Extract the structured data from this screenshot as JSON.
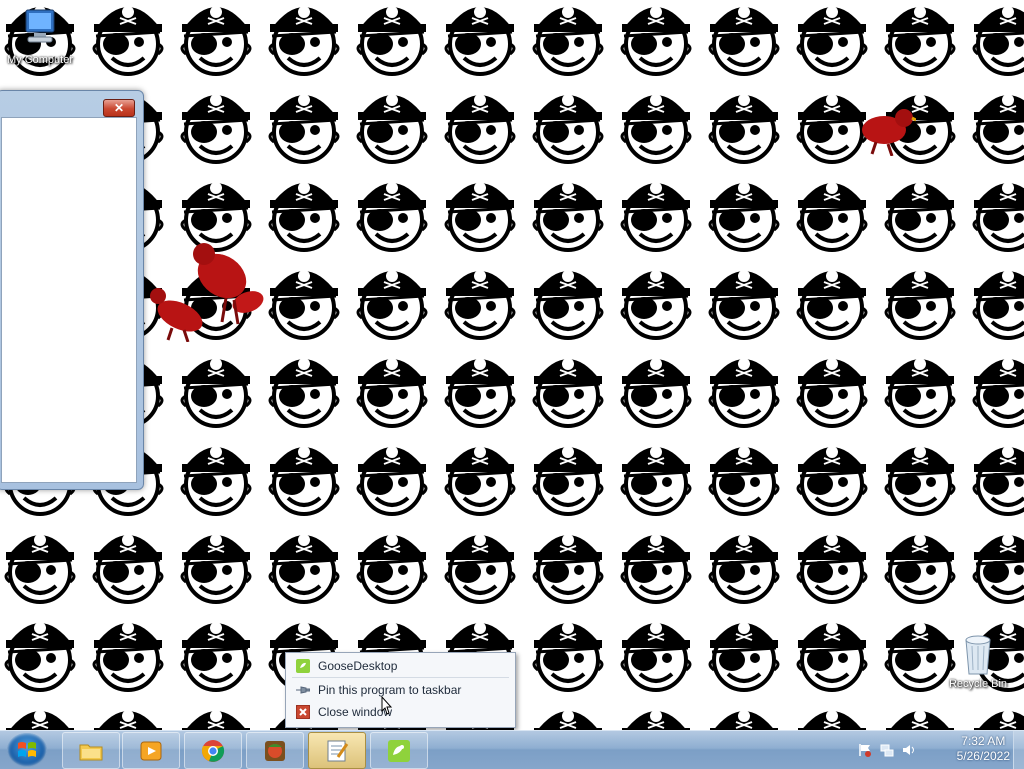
{
  "desktop": {
    "icons": [
      {
        "label": "My Computer",
        "icon": "computer-icon"
      },
      {
        "label": "Recycle Bin",
        "icon": "recycle-bin-icon"
      }
    ],
    "wallpaper": "pirate-face-pattern"
  },
  "window": {
    "close_label": "✕"
  },
  "jump_list": {
    "items": [
      {
        "label": "GooseDesktop",
        "icon": "goose-app-icon"
      },
      {
        "label": "Pin this program to taskbar",
        "icon": "pin-icon"
      },
      {
        "label": "Close window",
        "icon": "close-window-icon"
      }
    ]
  },
  "taskbar": {
    "start_icon": "windows-start-orb-icon",
    "buttons": [
      {
        "icon": "file-explorer-icon",
        "active": false
      },
      {
        "icon": "media-player-icon",
        "active": false
      },
      {
        "icon": "chrome-icon",
        "active": false
      },
      {
        "icon": "game-app-icon",
        "active": false
      },
      {
        "icon": "notepad-app-icon",
        "active": true
      },
      {
        "icon": "goose-desktop-icon",
        "active": false
      }
    ],
    "tray": {
      "icons": [
        "action-center-flag-icon",
        "network-icon",
        "volume-icon"
      ],
      "time": "7:32 AM",
      "date": "5/26/2022"
    }
  },
  "colors": {
    "taskbar": "#8eaed1",
    "goose": "#b81414",
    "jump_list_bg": "#f5f7fa"
  }
}
